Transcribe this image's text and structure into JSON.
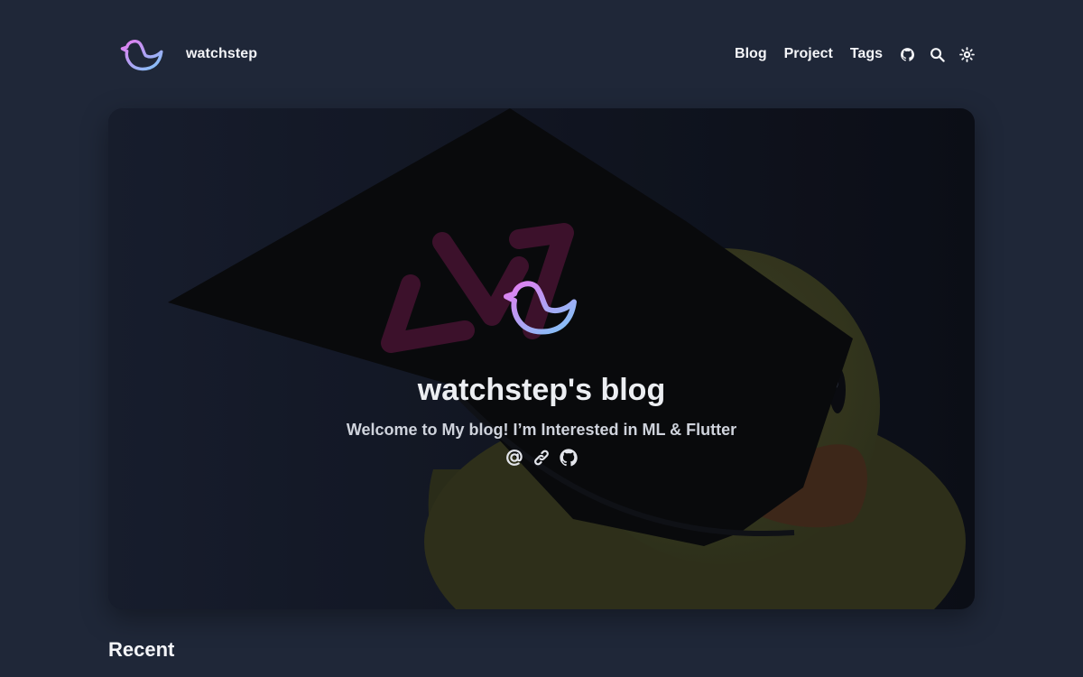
{
  "site": {
    "name": "watchstep",
    "logo_icon": "duck-logo-icon"
  },
  "nav": {
    "links": [
      {
        "label": "Blog"
      },
      {
        "label": "Project"
      },
      {
        "label": "Tags"
      }
    ],
    "icons": [
      "github-icon",
      "search-icon",
      "theme-toggle-sun-icon"
    ]
  },
  "hero": {
    "title": "watchstep's blog",
    "subtitle": "Welcome to My blog! I’m Interested in ML & Flutter",
    "background": "rubber-duck-with-graduation-cap-illustration",
    "social_icons": [
      "email-at-icon",
      "link-icon",
      "github-icon"
    ]
  },
  "sections": {
    "recent_title": "Recent"
  },
  "colors": {
    "background": "#1f2738",
    "logo_gradient_start": "#e67cf0",
    "logo_gradient_end": "#7cc6f8",
    "text": "#f4f5f8"
  }
}
